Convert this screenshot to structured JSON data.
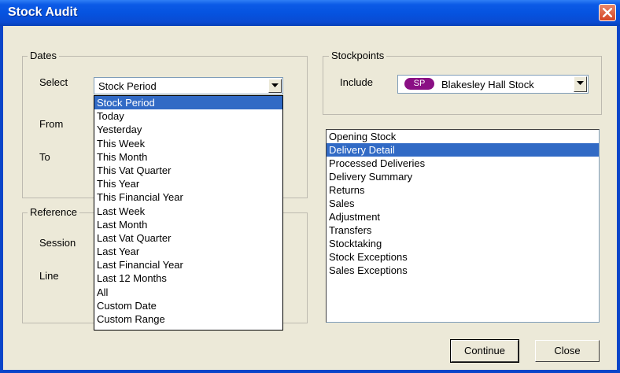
{
  "window": {
    "title": "Stock Audit"
  },
  "dates": {
    "legend": "Dates",
    "select_label": "Select",
    "select_value": "Stock Period",
    "from_label": "From",
    "to_label": "To",
    "options": [
      "Stock Period",
      "Today",
      "Yesterday",
      "This Week",
      "This Month",
      "This Vat Quarter",
      "This Year",
      "This Financial Year",
      "Last Week",
      "Last Month",
      "Last Vat Quarter",
      "Last Year",
      "Last Financial Year",
      "Last 12 Months",
      "All",
      "Custom Date",
      "Custom Range"
    ],
    "selected_option": "Stock Period"
  },
  "reference": {
    "legend": "Reference",
    "session_label": "Session",
    "line_label": "Line"
  },
  "stockpoints": {
    "legend": "Stockpoints",
    "include_label": "Include",
    "badge": "SP",
    "badge_color": "#8a0f84",
    "value": "Blakesley Hall Stock"
  },
  "report_types": {
    "items": [
      "Opening Stock",
      "Delivery Detail",
      "Processed Deliveries",
      "Delivery Summary",
      "Returns",
      "Sales",
      "Adjustment",
      "Transfers",
      "Stocktaking",
      "Stock Exceptions",
      "Sales Exceptions"
    ],
    "selected": "Delivery Detail"
  },
  "buttons": {
    "continue": "Continue",
    "close": "Close"
  },
  "colors": {
    "titlebar": "#0553e0",
    "selection": "#316ac5",
    "face": "#ece9d8"
  }
}
